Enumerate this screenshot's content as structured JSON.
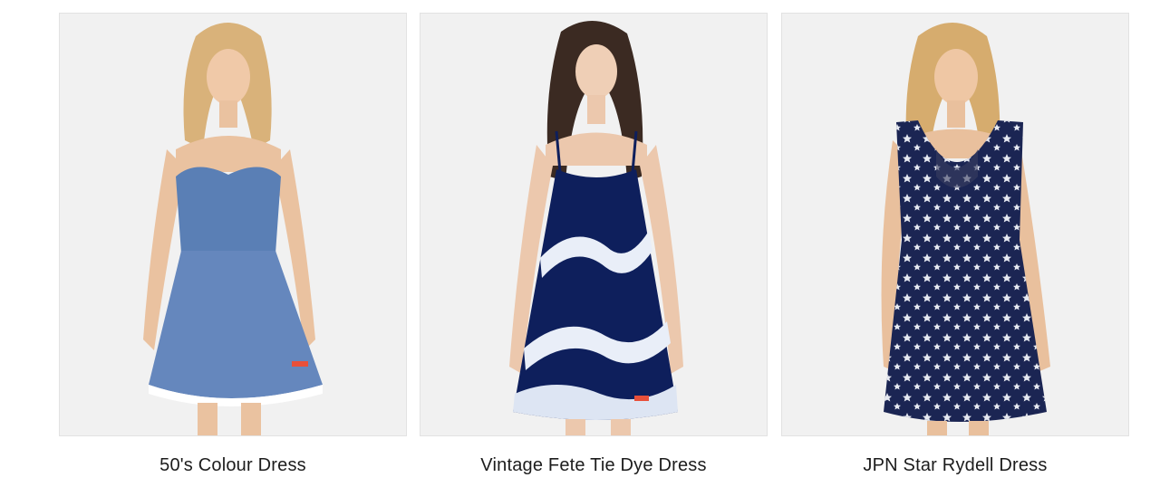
{
  "products": [
    {
      "title": "50's Colour Dress",
      "image_alt": "Model wearing a chambray strapless 50's Colour Dress",
      "dress_color": "#5a7fb5"
    },
    {
      "title": "Vintage Fete Tie Dye Dress",
      "image_alt": "Model wearing a navy tie dye strappy dress",
      "dress_color": "#0e1f5c"
    },
    {
      "title": "JPN Star Rydell Dress",
      "image_alt": "Model wearing a navy star print dress",
      "dress_color": "#1b2553"
    }
  ]
}
